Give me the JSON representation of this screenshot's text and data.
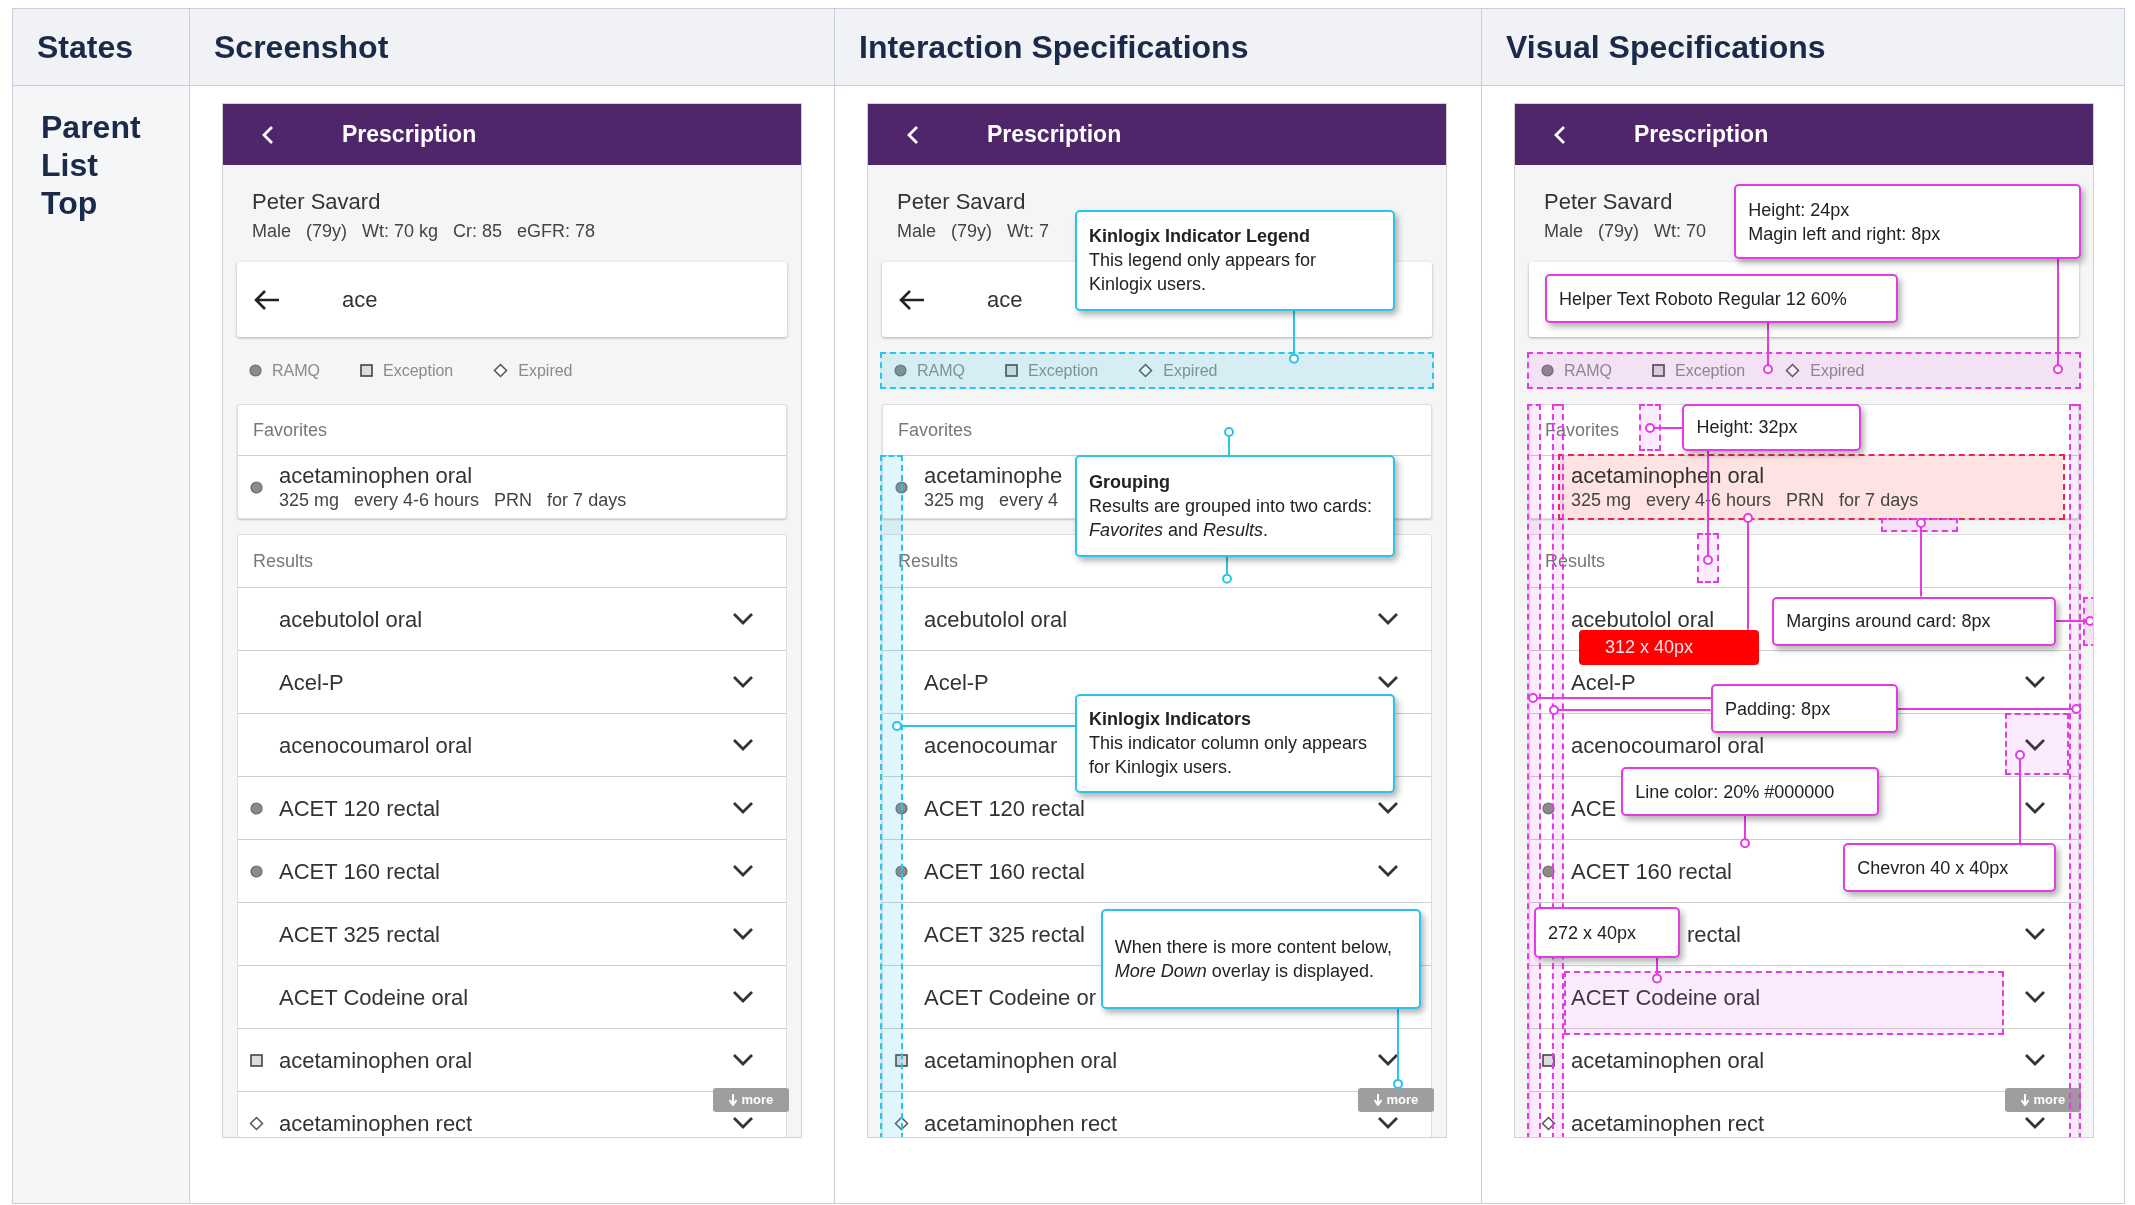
{
  "headers": [
    "States",
    "Screenshot",
    "Interaction Specifications",
    "Visual Specifications"
  ],
  "state": "Parent List Top",
  "panels": [
    {
      "kind": "plain",
      "phone": {
        "title": "Prescription",
        "patient_name": "Peter Savard",
        "patient_details": "Male   (79y)   Wt: 70 kg   Cr: 85   eGFR: 78",
        "search": {
          "back_arrow": true,
          "value": "ace"
        },
        "legend": [
          {
            "kind": "circle",
            "label": "RAMQ"
          },
          {
            "kind": "square",
            "label": "Exception"
          },
          {
            "kind": "diamond",
            "label": "Expired"
          }
        ],
        "favorites": {
          "heading": "Favorites",
          "items": [
            {
              "kind": "circle",
              "name": "acetaminophen oral",
              "details": "325 mg   every 4-6 hours   PRN   for 7 days"
            }
          ]
        },
        "results": {
          "heading": "Results",
          "items": [
            {
              "kind": "none",
              "name": "acebutolol oral",
              "chevron": true
            },
            {
              "kind": "none",
              "name": "Acel-P",
              "chevron": true
            },
            {
              "kind": "none",
              "name": "acenocoumarol oral",
              "chevron": true
            },
            {
              "kind": "circle",
              "name": "ACET 120 rectal",
              "chevron": true
            },
            {
              "kind": "circle",
              "name": "ACET 160 rectal",
              "chevron": true
            },
            {
              "kind": "none",
              "name": "ACET 325 rectal",
              "chevron": true
            },
            {
              "kind": "none",
              "name": "ACET Codeine oral",
              "chevron": true
            },
            {
              "kind": "square",
              "name": "acetaminophen oral",
              "chevron": true
            },
            {
              "kind": "diamond",
              "name": "acetaminophen rect",
              "chevron": true
            }
          ]
        },
        "more_label": "more"
      }
    },
    {
      "kind": "interaction",
      "phone": {
        "title": "Prescription",
        "patient_name": "Peter Savard",
        "patient_details": "Male   (79y)   Wt: 7",
        "search": {
          "back_arrow": true,
          "value": "ace"
        },
        "legend": [
          {
            "kind": "circle",
            "label": "RAMQ"
          },
          {
            "kind": "square",
            "label": "Exception"
          },
          {
            "kind": "diamond",
            "label": "Expired"
          }
        ],
        "favorites": {
          "heading": "Favorites",
          "items": [
            {
              "kind": "circle",
              "name": "acetaminophe",
              "details": "325 mg   every 4"
            }
          ]
        },
        "results": {
          "heading": "Results",
          "items": [
            {
              "kind": "none",
              "name": "acebutolol oral",
              "chevron": true
            },
            {
              "kind": "none",
              "name": "Acel-P",
              "chevron": true
            },
            {
              "kind": "none",
              "name": "acenocoumar",
              "chevron": false
            },
            {
              "kind": "circle",
              "name": "ACET 120 rectal",
              "chevron": true
            },
            {
              "kind": "circle",
              "name": "ACET 160 rectal",
              "chevron": true
            },
            {
              "kind": "none",
              "name": "ACET 325 rectal",
              "chevron": false
            },
            {
              "kind": "none",
              "name": "ACET Codeine or",
              "chevron": false
            },
            {
              "kind": "square",
              "name": "acetaminophen oral",
              "chevron": true
            },
            {
              "kind": "diamond",
              "name": "acetaminophen rect",
              "chevron": true
            }
          ]
        },
        "more_label": "more"
      },
      "annotations": [
        {
          "kind": "note",
          "title": "Kinlogix Indicator Legend",
          "lines": [
            "This legend only appears for Kinlogix users."
          ]
        },
        {
          "kind": "note",
          "title": "Grouping",
          "lines": [
            "Results are grouped into two cards: *Favorites* and *Results*."
          ]
        },
        {
          "kind": "note",
          "title": "Kinlogix Indicators",
          "lines": [
            "This indicator column only appears for Kinlogix users."
          ]
        },
        {
          "kind": "note",
          "lines": [
            "When there is more content below, *More Down* overlay is displayed."
          ]
        }
      ]
    },
    {
      "kind": "visual",
      "phone": {
        "title": "Prescription",
        "patient_name": "Peter Savard",
        "patient_details": "Male   (79y)   Wt: 70",
        "search": {
          "back_arrow": false
        },
        "legend": [
          {
            "kind": "circle",
            "label": "RAMQ"
          },
          {
            "kind": "square",
            "label": "Exception"
          },
          {
            "kind": "diamond",
            "label": "Expired"
          }
        ],
        "favorites": {
          "heading": "Favorites",
          "items": [
            {
              "kind": "circle",
              "name": "acetaminophen oral",
              "details": "325 mg   every 4-6 hours   PRN   for 7 days"
            }
          ]
        },
        "results": {
          "heading": "Results",
          "items": [
            {
              "kind": "none",
              "name": "acebutolol oral",
              "chevron": false
            },
            {
              "kind": "none",
              "name": "Acel-P",
              "chevron": true
            },
            {
              "kind": "none",
              "name": "acenocoumarol oral",
              "chevron": true
            },
            {
              "kind": "circle",
              "name": "ACE",
              "chevron": true
            },
            {
              "kind": "circle",
              "name": "ACET 160 rectal",
              "chevron": false
            },
            {
              "kind": "none",
              "name": "rectal",
              "chevron": true,
              "covered_start": true
            },
            {
              "kind": "none",
              "name": "ACET Codeine oral",
              "chevron": true
            },
            {
              "kind": "square",
              "name": "acetaminophen oral",
              "chevron": true
            },
            {
              "kind": "diamond",
              "name": "acetaminophen rect",
              "chevron": true
            }
          ]
        },
        "more_label": "more"
      },
      "annotations": [
        {
          "kind": "note",
          "lines": [
            "Height: 24px",
            "Magin left and right: 8px"
          ]
        },
        {
          "kind": "note",
          "lines": [
            "Helper Text Roboto Regular 12 60%"
          ]
        },
        {
          "kind": "note",
          "lines": [
            "Height: 32px"
          ]
        },
        {
          "kind": "note",
          "lines": [
            "Margins around card: 8px"
          ]
        },
        {
          "kind": "size_tag",
          "lines": [
            "312 x 40px"
          ]
        },
        {
          "kind": "note",
          "lines": [
            "Padding: 8px"
          ]
        },
        {
          "kind": "note",
          "lines": [
            "Line color: 20% #000000"
          ]
        },
        {
          "kind": "note",
          "lines": [
            "Chevron 40 x 40px"
          ]
        },
        {
          "kind": "note",
          "lines": [
            "272 x 40px"
          ]
        }
      ]
    }
  ]
}
